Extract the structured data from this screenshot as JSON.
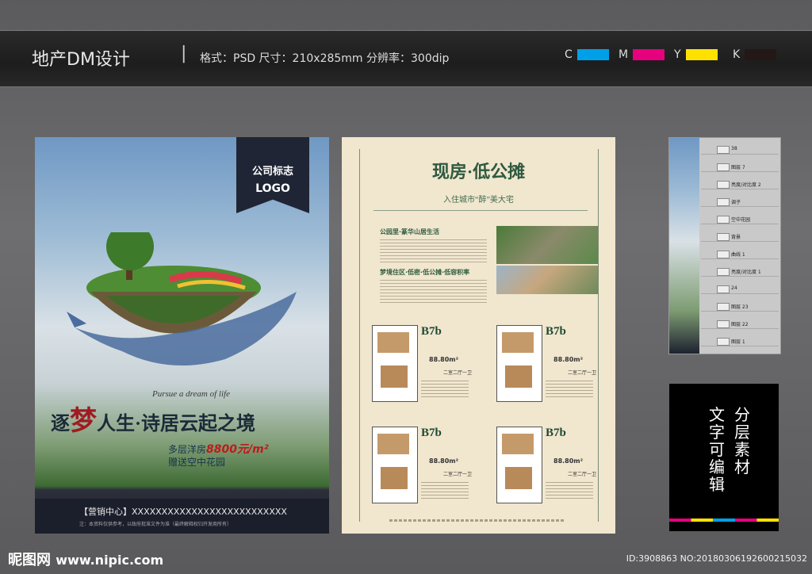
{
  "header": {
    "title": "地产DM设计",
    "separator": "|",
    "spec": "格式：PSD   尺寸：210x285mm  分辨率：300dip",
    "cmyk": [
      {
        "label": "C",
        "color": "#00a0e9"
      },
      {
        "label": "M",
        "color": "#e6007e"
      },
      {
        "label": "Y",
        "color": "#ffe100"
      },
      {
        "label": "K",
        "color": "#231815"
      }
    ]
  },
  "poster": {
    "logo_line1": "公司标志",
    "logo_line2": "LOGO",
    "tagline": "Pursue a dream of life",
    "headline_pre": "逐",
    "headline_meng": "梦",
    "headline_post": "人生·诗居云起之境",
    "price_prefix": "多层洋房",
    "price_value": "8800元/m²",
    "price_line2": "赠送空中花园",
    "footer_contact": "【营销中心】XXXXXXXXXXXXXXXXXXXXXXXXXX",
    "footer_note": "注：本资料仅供参考，以政府批准文件为准（最终解释权归开发商所有）"
  },
  "flyer": {
    "title": "现房·低公摊",
    "subtitle": "入住城市“醉”美大宅",
    "section1": "公园里·篆华山居生活",
    "section2": "梦境住区·低密·低公摊·低容积率",
    "plans": [
      {
        "code": "B7b",
        "area": "88.80m²",
        "rooms": "二室二厅一卫"
      },
      {
        "code": "B7b",
        "area": "88.80m²",
        "rooms": "二室二厅一卫"
      },
      {
        "code": "B7b",
        "area": "88.80m²",
        "rooms": "二室二厅一卫"
      },
      {
        "code": "B7b",
        "area": "88.80m²",
        "rooms": "二室二厅一卫"
      }
    ]
  },
  "layers": {
    "items": [
      "38",
      "图层 7",
      "亮度/对比度 2",
      "调子",
      "空中花园",
      "背景",
      "曲线 1",
      "亮度/对比度 1",
      "24",
      "图层 23",
      "图层 22",
      "图层 1"
    ]
  },
  "promo": {
    "col1": "分层素材",
    "col2": "文字可编辑"
  },
  "watermark": {
    "brand": "昵图网",
    "url": "www.nipic.com",
    "id_line": "ID:3908863 NO:20180306192600215032"
  }
}
